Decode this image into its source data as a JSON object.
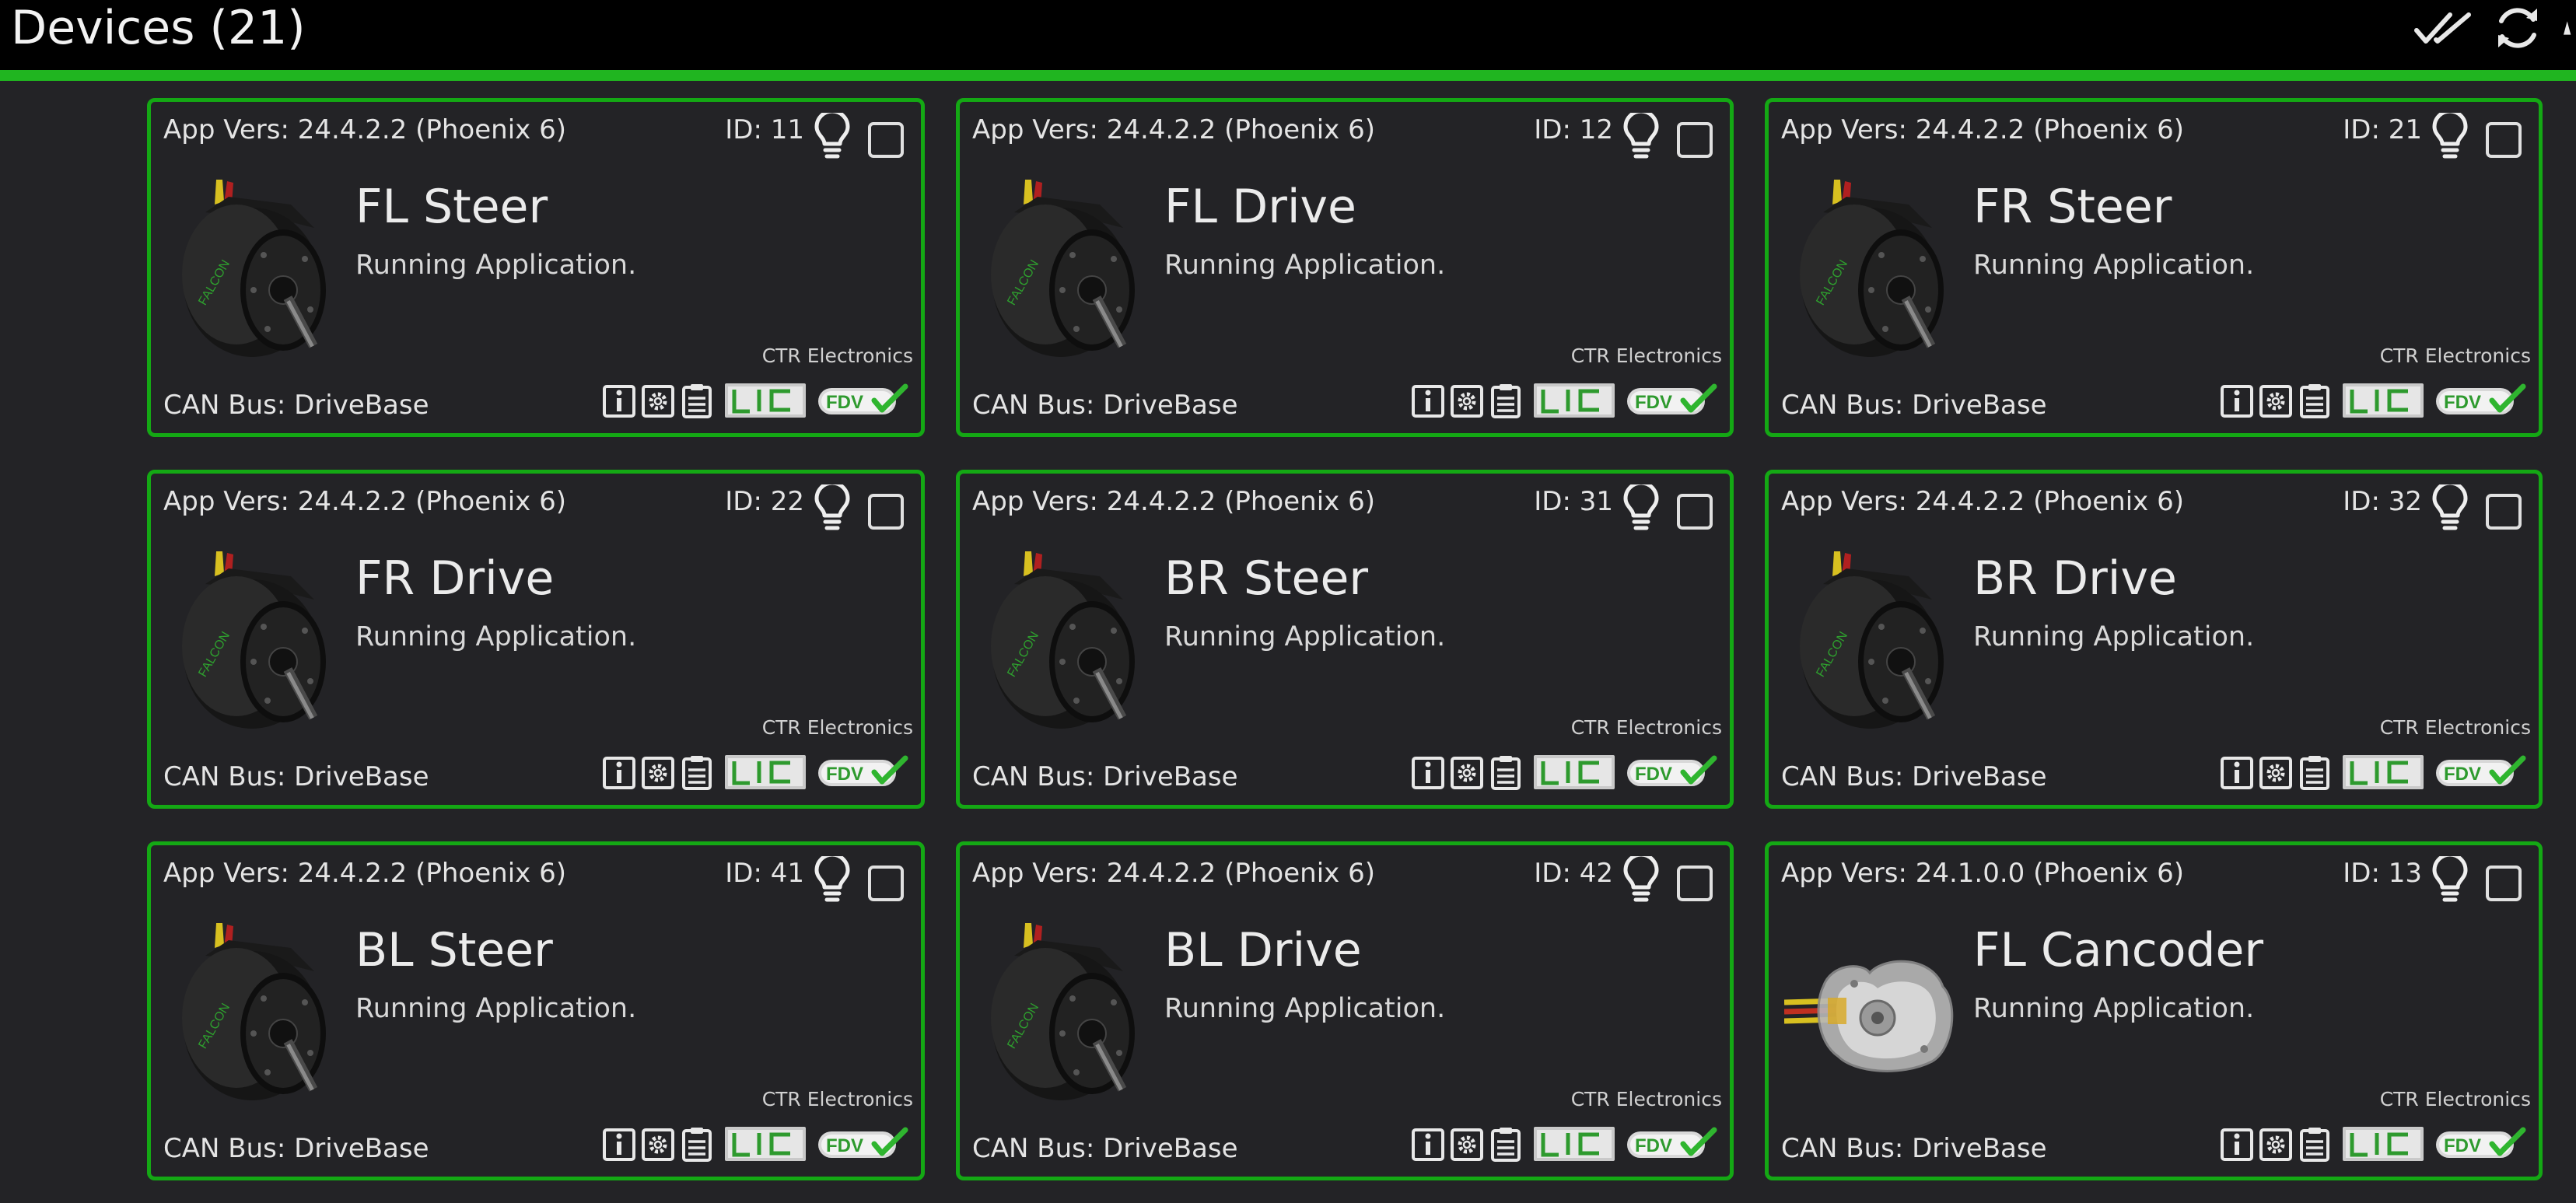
{
  "header": {
    "title": "Devices (21)",
    "icons": [
      "double-check-icon",
      "refresh-icon",
      "warning-icon"
    ],
    "accent": "#20b520"
  },
  "vendor_label": "CTR Electronics",
  "colors": {
    "card_border": "#14a814",
    "background": "#232326",
    "topbar": "#000000"
  },
  "devices": [
    {
      "app_vers": "App Vers: 24.4.2.2 (Phoenix 6)",
      "id": "ID: 11",
      "name": "FL Steer",
      "status": "Running Application.",
      "can_bus": "CAN Bus: DriveBase",
      "vendor": "CTR Electronics",
      "image": "motor"
    },
    {
      "app_vers": "App Vers: 24.4.2.2 (Phoenix 6)",
      "id": "ID: 12",
      "name": "FL Drive",
      "status": "Running Application.",
      "can_bus": "CAN Bus: DriveBase",
      "vendor": "CTR Electronics",
      "image": "motor"
    },
    {
      "app_vers": "App Vers: 24.4.2.2 (Phoenix 6)",
      "id": "ID: 21",
      "name": "FR Steer",
      "status": "Running Application.",
      "can_bus": "CAN Bus: DriveBase",
      "vendor": "CTR Electronics",
      "image": "motor"
    },
    {
      "app_vers": "App Vers: 24.4.2.2 (Phoenix 6)",
      "id": "ID: 22",
      "name": "FR Drive",
      "status": "Running Application.",
      "can_bus": "CAN Bus: DriveBase",
      "vendor": "CTR Electronics",
      "image": "motor"
    },
    {
      "app_vers": "App Vers: 24.4.2.2 (Phoenix 6)",
      "id": "ID: 31",
      "name": "BR Steer",
      "status": "Running Application.",
      "can_bus": "CAN Bus: DriveBase",
      "vendor": "CTR Electronics",
      "image": "motor"
    },
    {
      "app_vers": "App Vers: 24.4.2.2 (Phoenix 6)",
      "id": "ID: 32",
      "name": "BR Drive",
      "status": "Running Application.",
      "can_bus": "CAN Bus: DriveBase",
      "vendor": "CTR Electronics",
      "image": "motor"
    },
    {
      "app_vers": "App Vers: 24.4.2.2 (Phoenix 6)",
      "id": "ID: 41",
      "name": "BL Steer",
      "status": "Running Application.",
      "can_bus": "CAN Bus: DriveBase",
      "vendor": "CTR Electronics",
      "image": "motor"
    },
    {
      "app_vers": "App Vers: 24.4.2.2 (Phoenix 6)",
      "id": "ID: 42",
      "name": "BL Drive",
      "status": "Running Application.",
      "can_bus": "CAN Bus: DriveBase",
      "vendor": "CTR Electronics",
      "image": "motor"
    },
    {
      "app_vers": "App Vers: 24.1.0.0 (Phoenix 6)",
      "id": "ID: 13",
      "name": "FL Cancoder",
      "status": "Running Application.",
      "can_bus": "CAN Bus: DriveBase",
      "vendor": "CTR Electronics",
      "image": "cancoder"
    }
  ]
}
